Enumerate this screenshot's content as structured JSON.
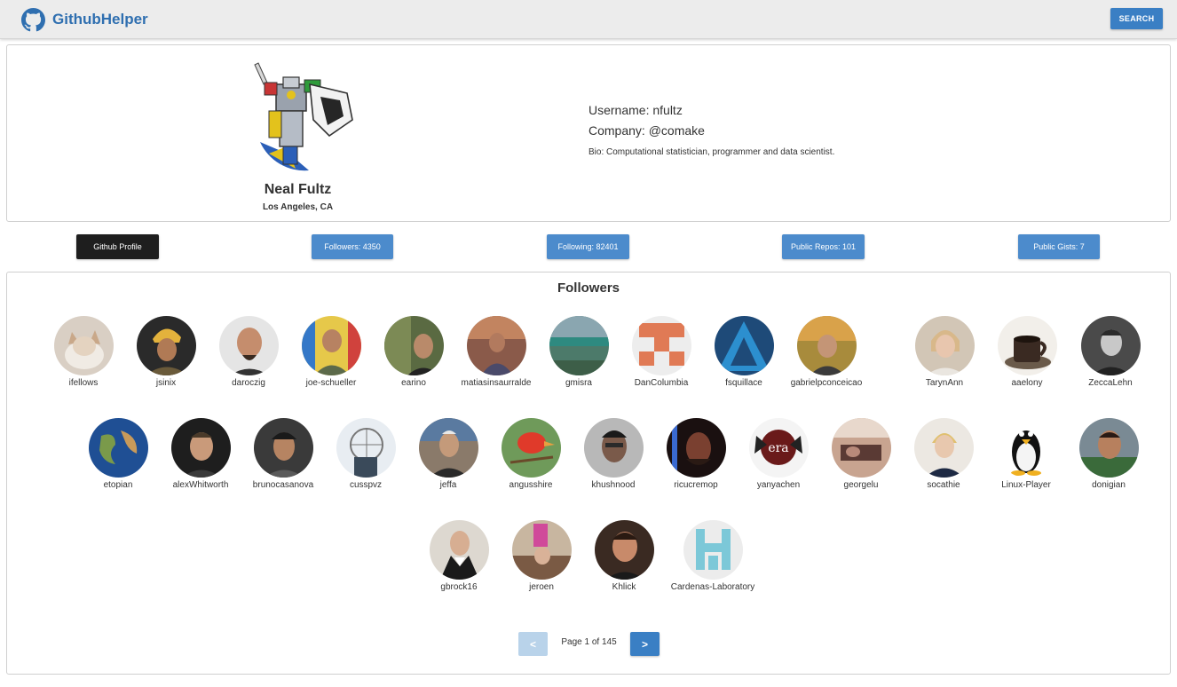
{
  "navbar": {
    "brand": "GithubHelper",
    "brand_icon": "github-octocat-icon",
    "brand_color": "#2f6fb0",
    "search_label": "SEARCH"
  },
  "profile": {
    "avatar_icon": "voltron-robot-avatar",
    "name": "Neal Fultz",
    "location": "Los Angeles, CA",
    "username": "Username: nfultz",
    "company": "Company: @comake",
    "bio": "Bio: Computational statistician, programmer and data scientist."
  },
  "stats": {
    "github_profile": "Github Profile",
    "followers": "Followers: 4350",
    "following": "Following: 82401",
    "public_repos": "Public Repos: 101",
    "public_gists": "Public Gists: 7"
  },
  "followers_section": {
    "title": "Followers",
    "items": [
      {
        "login": "ifellows"
      },
      {
        "login": "jsinix"
      },
      {
        "login": "daroczig"
      },
      {
        "login": "joe-schueller"
      },
      {
        "login": "earino"
      },
      {
        "login": "matiasinsaurralde"
      },
      {
        "login": "gmisra"
      },
      {
        "login": "DanColumbia"
      },
      {
        "login": "fsquillace"
      },
      {
        "login": "gabrielpconceicao"
      },
      {
        "login": "TarynAnn"
      },
      {
        "login": "aaelony"
      },
      {
        "login": "ZeccaLehn"
      },
      {
        "login": "etopian"
      },
      {
        "login": "alexWhitworth"
      },
      {
        "login": "brunocasanova"
      },
      {
        "login": "cusspvz"
      },
      {
        "login": "jeffa"
      },
      {
        "login": "angusshire"
      },
      {
        "login": "khushnood"
      },
      {
        "login": "ricucremop"
      },
      {
        "login": "yanyachen"
      },
      {
        "login": "georgelu"
      },
      {
        "login": "socathie"
      },
      {
        "login": "Linux-Player"
      },
      {
        "login": "donigian"
      },
      {
        "login": "gbrock16"
      },
      {
        "login": "jeroen"
      },
      {
        "login": "Khlick"
      },
      {
        "login": "Cardenas-Laboratory"
      }
    ]
  },
  "pagination": {
    "prev_label": "<",
    "next_label": ">",
    "page_text": "Page 1 of 145"
  }
}
